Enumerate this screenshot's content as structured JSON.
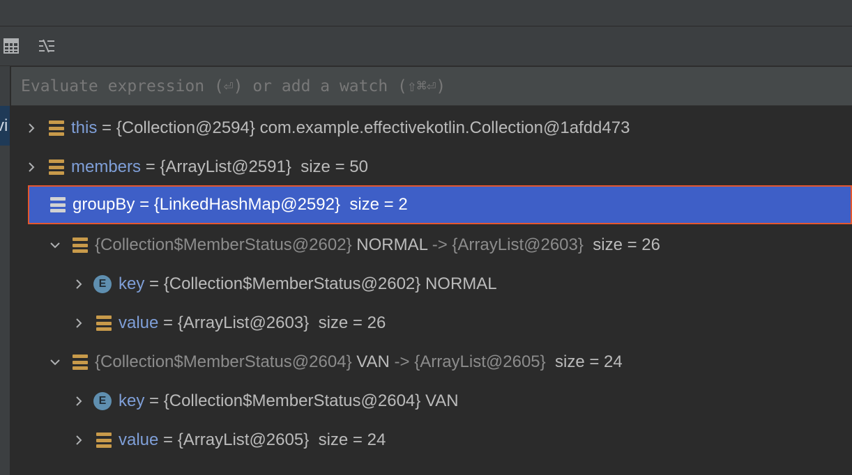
{
  "watch": {
    "placeholder": "Evaluate expression (⏎) or add a watch (⇧⌘⏎)"
  },
  "left_tab": {
    "label": "vi"
  },
  "variables": [
    {
      "name": "this",
      "ref": "{Collection@2594}",
      "value": "com.example.effectivekotlin.Collection@1afdd473"
    },
    {
      "name": "members",
      "ref": "{ArrayList@2591}",
      "size": "size = 50"
    },
    {
      "name": "groupBy",
      "ref": "{LinkedHashMap@2592}",
      "size": "size = 2"
    }
  ],
  "entries": [
    {
      "key_ref": "{Collection$MemberStatus@2602}",
      "key_name": "NORMAL",
      "arrow": "->",
      "value_ref": "{ArrayList@2603}",
      "size": "size = 26",
      "key_row": {
        "icon_letter": "E",
        "name": "key",
        "text": "{Collection$MemberStatus@2602} NORMAL"
      },
      "value_row": {
        "name": "value",
        "ref": "{ArrayList@2603}",
        "size": "size = 26"
      }
    },
    {
      "key_ref": "{Collection$MemberStatus@2604}",
      "key_name": "VAN",
      "arrow": "->",
      "value_ref": "{ArrayList@2605}",
      "size": "size = 24",
      "key_row": {
        "icon_letter": "E",
        "name": "key",
        "text": "{Collection$MemberStatus@2604} VAN"
      },
      "value_row": {
        "name": "value",
        "ref": "{ArrayList@2605}",
        "size": "size = 24"
      }
    }
  ],
  "eq": "="
}
